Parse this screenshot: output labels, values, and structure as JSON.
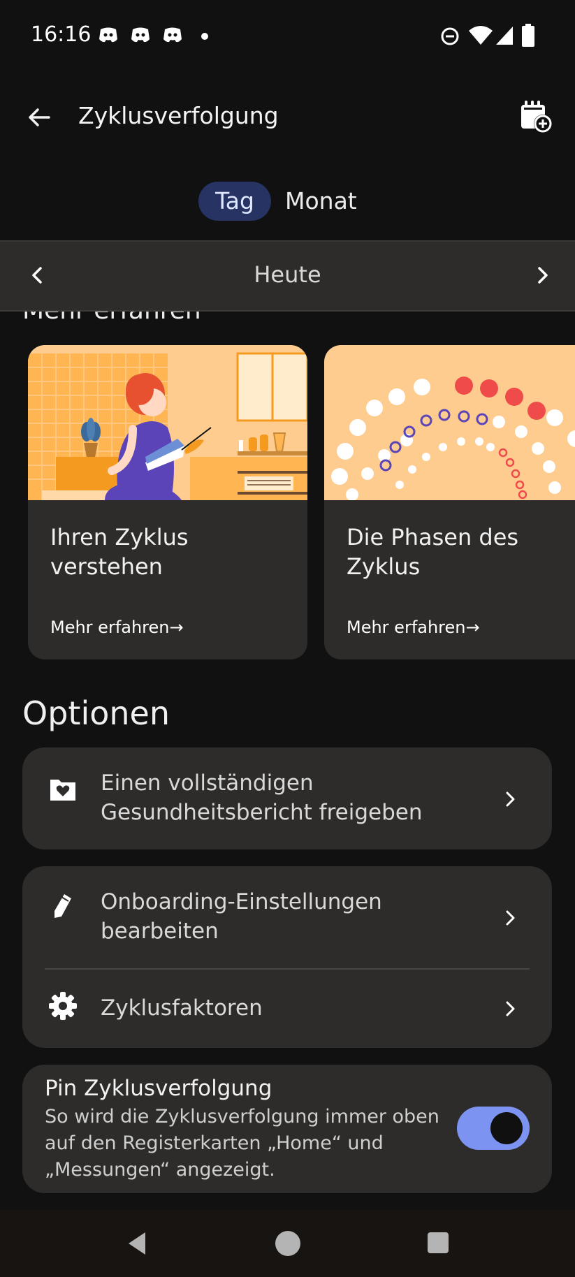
{
  "status_bar": {
    "time": "16:16",
    "notification_icons": [
      "discord-icon",
      "discord-icon",
      "discord-icon",
      "dot-icon"
    ],
    "system_icons": [
      "do-not-disturb-icon",
      "wifi-icon",
      "cellular-signal-icon",
      "battery-icon"
    ]
  },
  "app_bar": {
    "title": "Zyklusverfolgung",
    "back_icon": "arrow-left-icon",
    "action_icon": "calendar-add-icon"
  },
  "tabs": {
    "items": [
      {
        "label": "Tag",
        "selected": true
      },
      {
        "label": "Monat",
        "selected": false
      }
    ]
  },
  "date_nav": {
    "label": "Heute",
    "prev_icon": "chevron-left-icon",
    "next_icon": "chevron-right-icon"
  },
  "learn_section": {
    "heading": "Mehr erfahren",
    "cards": [
      {
        "title": "Ihren Zyklus verstehen",
        "link": "Mehr erfahren→"
      },
      {
        "title": "Die Phasen des Zyklus",
        "link": "Mehr erfahren→"
      }
    ]
  },
  "options": {
    "heading": "Optionen",
    "share_report": {
      "label": "Einen vollständigen Gesundheitsbericht freigeben",
      "icon": "folder-heart-icon"
    },
    "onboarding": {
      "label": "Onboarding-Einstellungen bearbeiten",
      "icon": "pencil-icon"
    },
    "cycle_factors": {
      "label": "Zyklusfaktoren",
      "icon": "gear-icon"
    }
  },
  "pin": {
    "title": "Pin Zyklusverfolgung",
    "description": "So wird die Zyklusverfolgung immer oben auf den Registerkarten „Home“ und „Messungen“ angezeigt.",
    "enabled": true
  },
  "colors": {
    "background": "#111111",
    "surface": "#2d2c2a",
    "accent": "#7c93f2",
    "tab_selected": "#263363",
    "illustration_bg": "#ffcc8f",
    "period_red": "#ef4b4b",
    "phase_purple": "#5a44b8"
  }
}
